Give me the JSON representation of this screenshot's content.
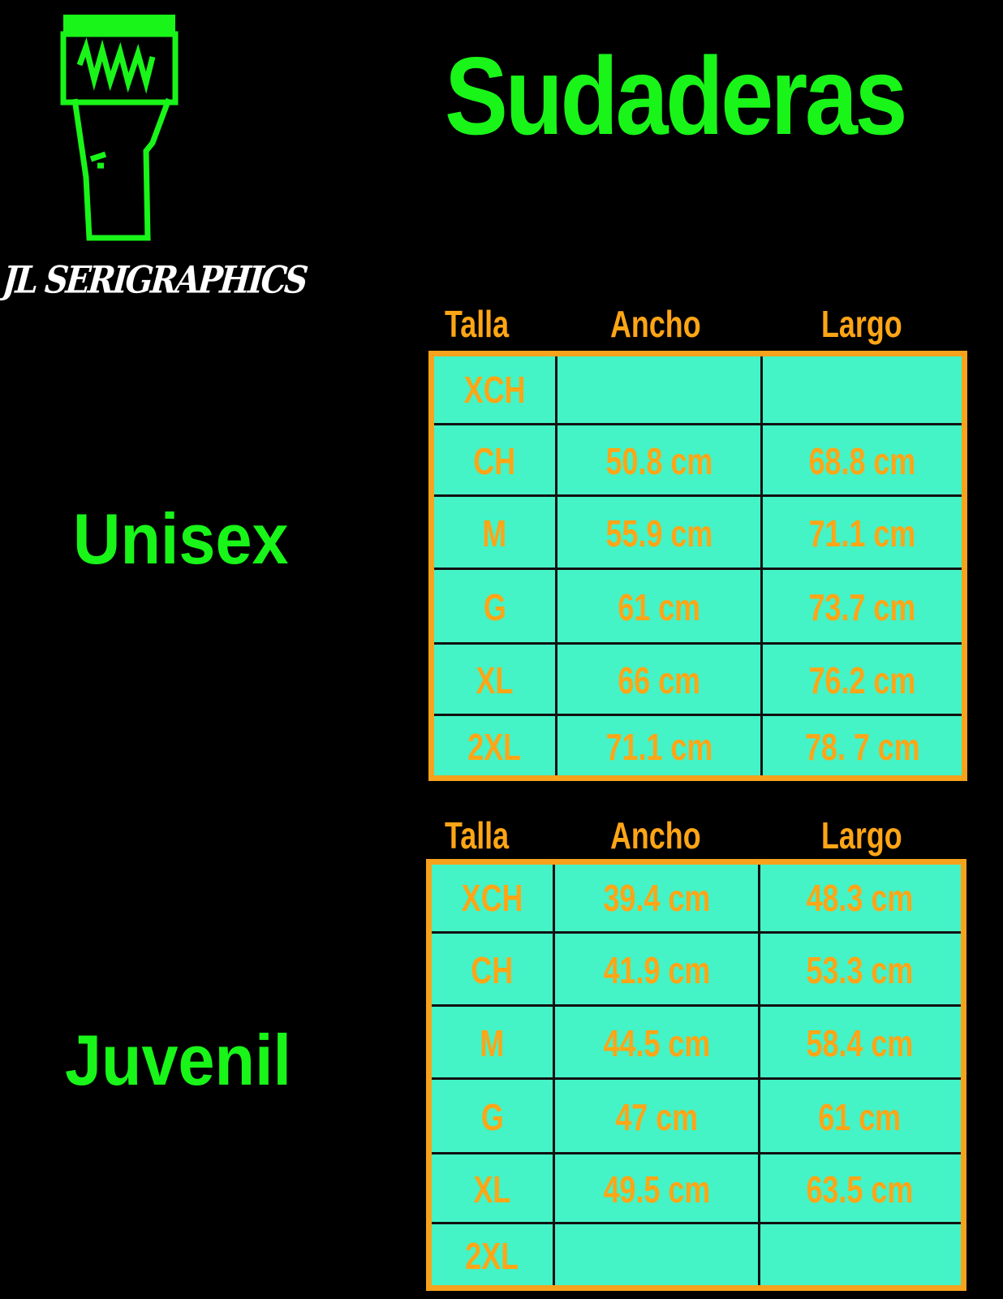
{
  "brand": {
    "name": "JL SERIGRAPHICS",
    "logo_color": "#19f519"
  },
  "title": "Sudaderas",
  "colors": {
    "label_green": "#19f519",
    "cell_text": "#ffa516",
    "table_bg": "#44f3c6",
    "table_border": "#f7a21c"
  },
  "unisex": {
    "label": "Unisex",
    "headers": {
      "size": "Talla",
      "width": "Ancho",
      "length": "Largo"
    },
    "rows": [
      {
        "size": "XCH",
        "width": "",
        "length": ""
      },
      {
        "size": "CH",
        "width": "50.8 cm",
        "length": "68.8 cm"
      },
      {
        "size": "M",
        "width": "55.9 cm",
        "length": "71.1 cm"
      },
      {
        "size": "G",
        "width": "61 cm",
        "length": "73.7 cm"
      },
      {
        "size": "XL",
        "width": "66 cm",
        "length": "76.2 cm"
      },
      {
        "size": "2XL",
        "width": "71.1 cm",
        "length": "78. 7 cm"
      }
    ]
  },
  "juvenil": {
    "label": "Juvenil",
    "headers": {
      "size": "Talla",
      "width": "Ancho",
      "length": "Largo"
    },
    "rows": [
      {
        "size": "XCH",
        "width": "39.4 cm",
        "length": "48.3 cm"
      },
      {
        "size": "CH",
        "width": "41.9 cm",
        "length": "53.3 cm"
      },
      {
        "size": "M",
        "width": "44.5 cm",
        "length": "58.4 cm"
      },
      {
        "size": "G",
        "width": "47 cm",
        "length": "61 cm"
      },
      {
        "size": "XL",
        "width": "49.5 cm",
        "length": "63.5 cm"
      },
      {
        "size": "2XL",
        "width": "",
        "length": ""
      }
    ]
  }
}
